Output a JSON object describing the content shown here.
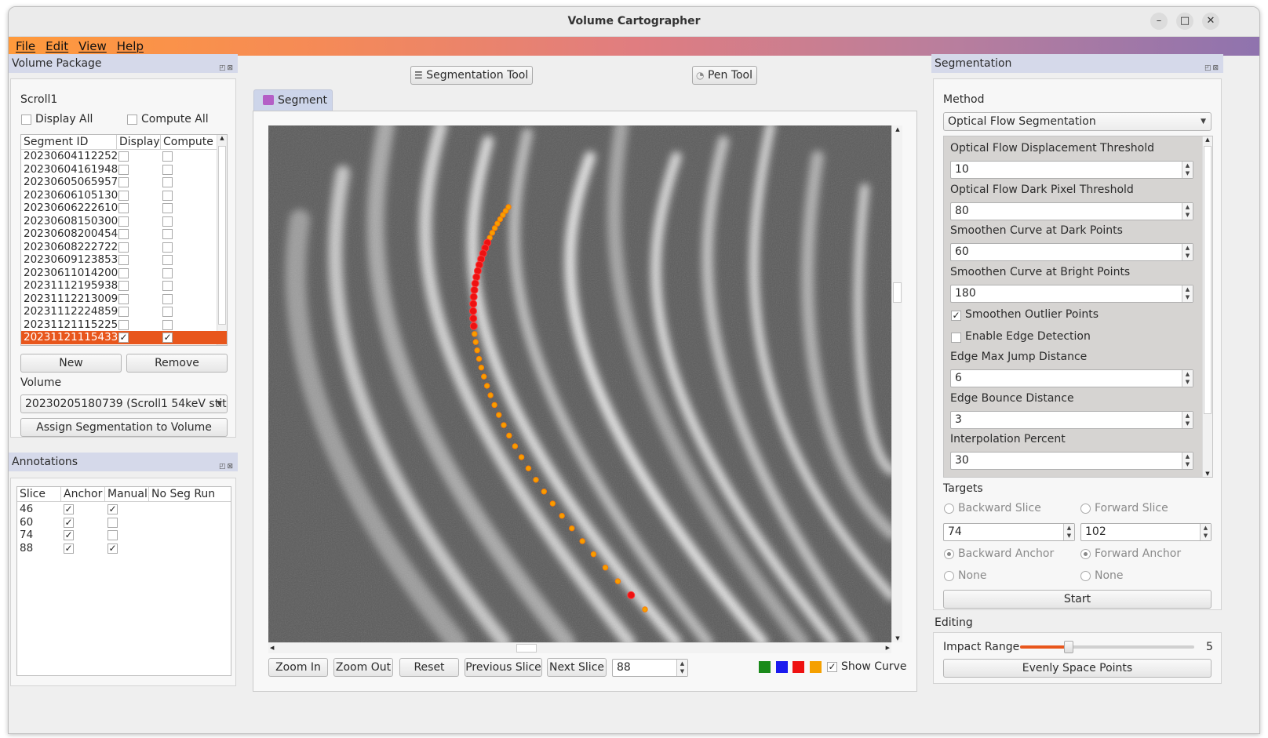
{
  "window": {
    "title": "Volume Cartographer"
  },
  "menu": [
    "File",
    "Edit",
    "View",
    "Help"
  ],
  "volume_package": {
    "dock_title": "Volume Package",
    "scroll_name": "Scroll1",
    "display_all_label": "Display All",
    "compute_all_label": "Compute All",
    "columns": [
      "Segment ID",
      "Display",
      "Compute"
    ],
    "segments": [
      {
        "id": "20230604112252",
        "display": false,
        "compute": false
      },
      {
        "id": "20230604161948",
        "display": false,
        "compute": false
      },
      {
        "id": "20230605065957",
        "display": false,
        "compute": false
      },
      {
        "id": "20230606105130",
        "display": false,
        "compute": false
      },
      {
        "id": "20230606222610",
        "display": false,
        "compute": false
      },
      {
        "id": "20230608150300",
        "display": false,
        "compute": false
      },
      {
        "id": "20230608200454",
        "display": false,
        "compute": false
      },
      {
        "id": "20230608222722",
        "display": false,
        "compute": false
      },
      {
        "id": "20230609123853",
        "display": false,
        "compute": false
      },
      {
        "id": "20230611014200",
        "display": false,
        "compute": false
      },
      {
        "id": "20231112195938",
        "display": false,
        "compute": false
      },
      {
        "id": "20231112213009",
        "display": false,
        "compute": false
      },
      {
        "id": "20231112224859",
        "display": false,
        "compute": false
      },
      {
        "id": "20231121115225",
        "display": false,
        "compute": false
      },
      {
        "id": "20231121115433",
        "display": true,
        "compute": true,
        "selected": true
      }
    ],
    "new_label": "New",
    "remove_label": "Remove",
    "volume_label": "Volume",
    "volume_value": "20230205180739 (Scroll1 54keV stit",
    "assign_label": "Assign Segmentation to Volume"
  },
  "annotations": {
    "dock_title": "Annotations",
    "columns": [
      "Slice",
      "Anchor",
      "Manual",
      "No Seg Run"
    ],
    "rows": [
      {
        "slice": "46",
        "anchor": true,
        "manual": true
      },
      {
        "slice": "60",
        "anchor": true,
        "manual": false
      },
      {
        "slice": "74",
        "anchor": true,
        "manual": false
      },
      {
        "slice": "88",
        "anchor": true,
        "manual": true
      }
    ]
  },
  "center": {
    "seg_tool_label": "Segmentation Tool",
    "pen_tool_label": "Pen Tool",
    "tab_label": "Segment",
    "zoom_in": "Zoom In",
    "zoom_out": "Zoom Out",
    "reset": "Reset",
    "prev_slice": "Previous Slice",
    "next_slice": "Next Slice",
    "slice_value": "88",
    "show_curve_label": "Show Curve",
    "show_curve": true,
    "swatch_colors": [
      "#1a8a1a",
      "#1a1aee",
      "#ee1111",
      "#f5a000"
    ]
  },
  "segmentation": {
    "dock_title": "Segmentation",
    "method_label": "Method",
    "method_value": "Optical Flow Segmentation",
    "params": [
      {
        "label": "Optical Flow Displacement Threshold",
        "value": "10"
      },
      {
        "label": "Optical Flow Dark Pixel Threshold",
        "value": "80"
      },
      {
        "label": "Smoothen Curve at Dark Points",
        "value": "60"
      },
      {
        "label": "Smoothen Curve at Bright Points",
        "value": "180"
      }
    ],
    "smoothen_outlier_label": "Smoothen Outlier Points",
    "smoothen_outlier": true,
    "edge_detection_label": "Enable Edge Detection",
    "edge_detection": false,
    "params2": [
      {
        "label": "Edge Max Jump Distance",
        "value": "6"
      },
      {
        "label": "Edge Bounce Distance",
        "value": "3"
      },
      {
        "label": "Interpolation Percent",
        "value": "30"
      }
    ],
    "targets_label": "Targets",
    "backward_slice_label": "Backward Slice",
    "forward_slice_label": "Forward Slice",
    "backward_value": "74",
    "forward_value": "102",
    "backward_anchor_label": "Backward Anchor",
    "forward_anchor_label": "Forward Anchor",
    "none_label": "None",
    "start_label": "Start"
  },
  "editing": {
    "title": "Editing",
    "impact_label": "Impact Range",
    "impact_value": "5",
    "impact_fraction": 0.28,
    "evenly_label": "Evenly Space Points"
  }
}
